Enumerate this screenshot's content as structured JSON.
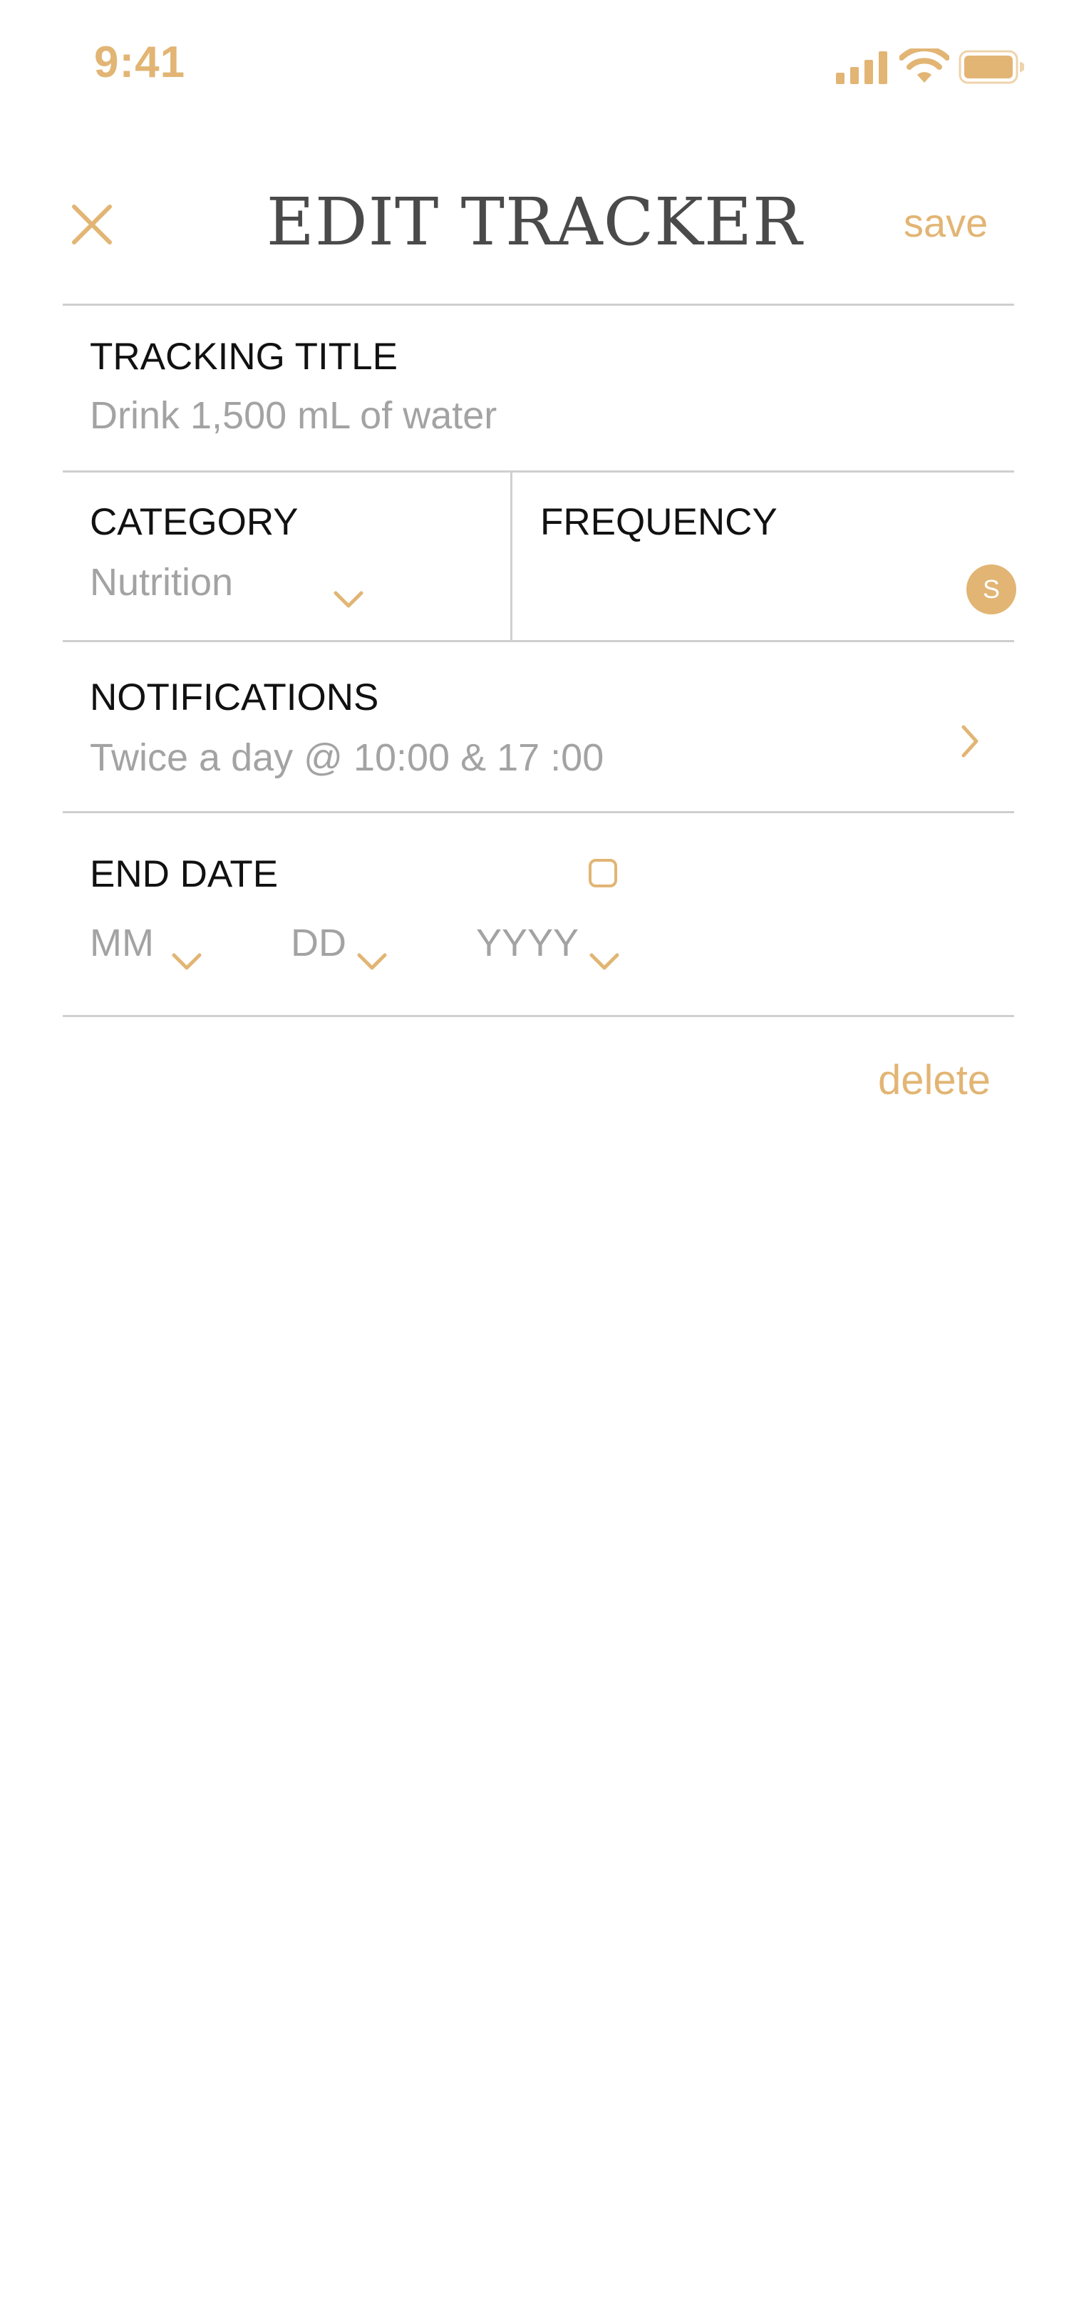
{
  "status_bar": {
    "time": "9:41"
  },
  "header": {
    "title": "EDIT TRACKER",
    "save_label": "save"
  },
  "form": {
    "tracking_title": {
      "label": "TRACKING TITLE",
      "value": "Drink 1,500 mL of water"
    },
    "category": {
      "label": "CATEGORY",
      "value": "Nutrition"
    },
    "frequency": {
      "label": "FREQUENCY",
      "badge": "S"
    },
    "notifications": {
      "label": "NOTIFICATIONS",
      "value": "Twice a day @ 10:00 & 17 :00"
    },
    "end_date": {
      "label": "END DATE",
      "month_placeholder": "MM",
      "day_placeholder": "DD",
      "year_placeholder": "YYYY",
      "enabled": false
    }
  },
  "actions": {
    "delete_label": "delete"
  },
  "colors": {
    "accent": "#E2B574",
    "divider": "#cfcfcf",
    "label": "#111111",
    "value": "#a3a3a3",
    "title": "#4a4a4a"
  },
  "icons": {
    "close": "close-icon",
    "dropdown": "chevron-down-icon",
    "disclosure": "chevron-right-icon",
    "signal": "cellular-signal-icon",
    "wifi": "wifi-icon",
    "battery": "battery-icon"
  }
}
